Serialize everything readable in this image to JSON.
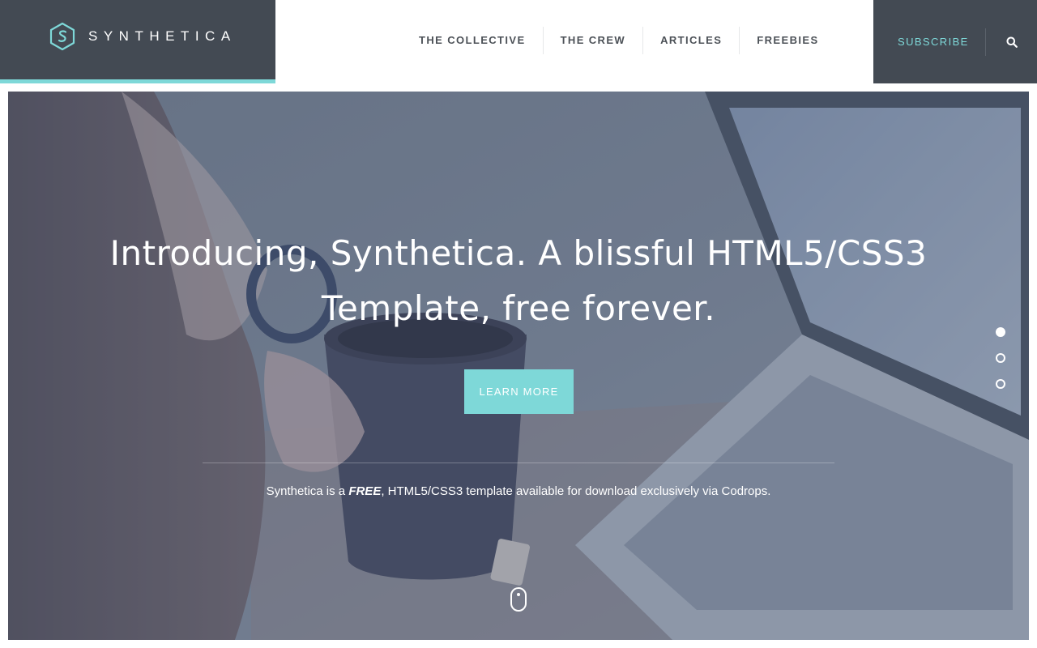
{
  "brand": {
    "name": "SYNTHETICA",
    "logo_icon": "synthetica-s-hexagon-icon",
    "accent_color": "#7ed8d8",
    "panel_color": "#434a53"
  },
  "nav": {
    "items": [
      {
        "label": "THE COLLECTIVE"
      },
      {
        "label": "THE CREW"
      },
      {
        "label": "ARTICLES"
      },
      {
        "label": "FREEBIES"
      }
    ]
  },
  "utility": {
    "subscribe_label": "SUBSCRIBE",
    "search_icon": "search-icon"
  },
  "hero": {
    "background": "photo: person drinking from a mug in front of a laptop",
    "title": "Introducing, Synthetica. A blissful HTML5/CSS3 Template, free forever.",
    "cta_label": "LEARN MORE",
    "tagline_prefix": "Synthetica is a ",
    "tagline_emphasis": "FREE",
    "tagline_suffix": ", HTML5/CSS3 template available for download exclusively via Codrops.",
    "slides": {
      "count": 3,
      "active": 1
    },
    "scroll_icon": "mouse-scroll-icon"
  }
}
